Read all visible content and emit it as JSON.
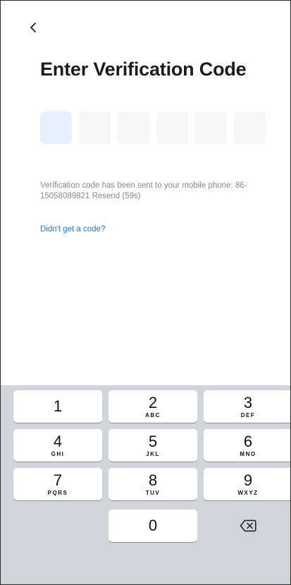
{
  "header": {
    "back_icon": "chevron-left-icon",
    "title": "Enter Verification Code"
  },
  "code_input": {
    "length": 6,
    "active_index": 0,
    "active_color": "#e7f1fd",
    "inactive_color": "#f6f6f6"
  },
  "info": {
    "message": "Verification code has been sent to your mobile phone: 86-15058089821",
    "resend_label": "Resend (59s)"
  },
  "help_link": {
    "label": "Didn't get a code?",
    "color": "#1f7be0"
  },
  "keypad": {
    "keys": [
      {
        "digit": "1",
        "letters": ""
      },
      {
        "digit": "2",
        "letters": "ABC"
      },
      {
        "digit": "3",
        "letters": "DEF"
      },
      {
        "digit": "4",
        "letters": "GHI"
      },
      {
        "digit": "5",
        "letters": "JKL"
      },
      {
        "digit": "6",
        "letters": "MNO"
      },
      {
        "digit": "7",
        "letters": "PQRS"
      },
      {
        "digit": "8",
        "letters": "TUV"
      },
      {
        "digit": "9",
        "letters": "WXYZ"
      },
      {
        "digit": "0",
        "letters": ""
      }
    ],
    "delete_icon": "backspace-icon"
  }
}
